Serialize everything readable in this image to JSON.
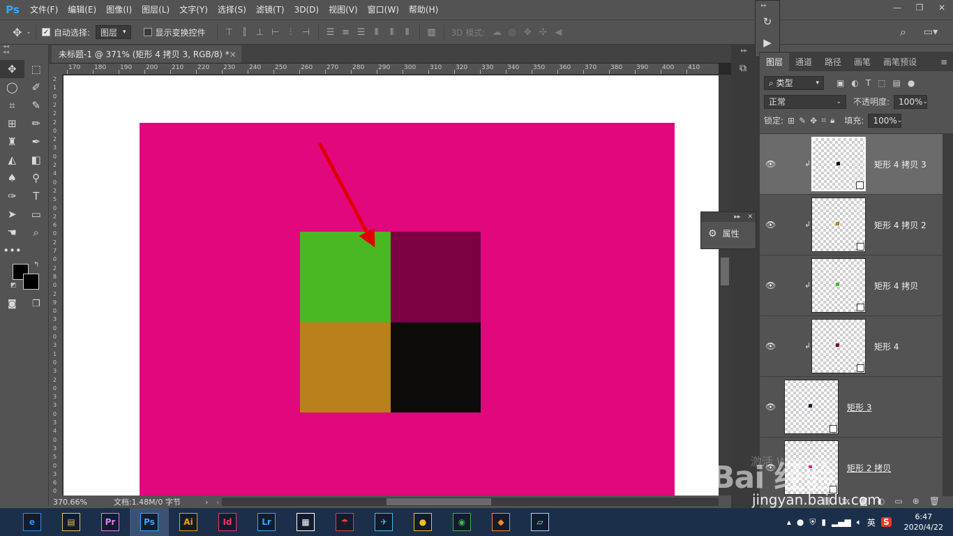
{
  "app": {
    "logo": "Ps",
    "brand_color": "#31a8ff"
  },
  "menu": [
    "文件(F)",
    "编辑(E)",
    "图像(I)",
    "图层(L)",
    "文字(Y)",
    "选择(S)",
    "滤镜(T)",
    "3D(D)",
    "视图(V)",
    "窗口(W)",
    "帮助(H)"
  ],
  "options": {
    "auto_select_label": "自动选择:",
    "auto_select_checked": "✓",
    "target": "图层",
    "show_transform_label": "显示变换控件",
    "mode_3d_label": "3D 模式:"
  },
  "document": {
    "tab_title": "未标题-1 @ 371% (矩形 4 拷贝 3, RGB/8) *",
    "tab_close": "×",
    "ruler_labels": [
      "170",
      "180",
      "190",
      "200",
      "210",
      "220",
      "230",
      "240",
      "250",
      "260",
      "270",
      "280",
      "290",
      "300",
      "310",
      "320",
      "330",
      "340",
      "350",
      "360",
      "370",
      "380",
      "390",
      "400",
      "410"
    ],
    "left_ruler_digits": [
      "2",
      "1",
      "0",
      "2",
      "2",
      "2",
      "0",
      "2",
      "3",
      "0",
      "2",
      "4",
      "0",
      "2",
      "5",
      "0",
      "2",
      "6",
      "0",
      "2",
      "7",
      "0",
      "2",
      "8",
      "0",
      "2",
      "9",
      "0",
      "3",
      "0",
      "0",
      "3",
      "1",
      "0",
      "3",
      "2",
      "0",
      "3",
      "3",
      "0",
      "3",
      "4",
      "0",
      "3",
      "5",
      "0",
      "3",
      "6",
      "0"
    ]
  },
  "canvas": {
    "background": "#ffffff",
    "shape_color": "#e3077e",
    "squares": [
      {
        "name": "green-square",
        "color": "#49b823"
      },
      {
        "name": "maroon-square",
        "color": "#7c0042"
      },
      {
        "name": "ochre-square",
        "color": "#b9801c"
      },
      {
        "name": "black-square",
        "color": "#0e0c0b"
      }
    ],
    "arrow_color": "#e00000"
  },
  "status": {
    "zoom": "370.66%",
    "doc_info": "文档:1.48M/0 字节"
  },
  "properties_panel": {
    "label": "属性"
  },
  "layers_panel": {
    "tabs": [
      "图层",
      "通道",
      "路径",
      "画笔",
      "画笔预设"
    ],
    "active_tab": 0,
    "filter_label": "类型",
    "blend_mode": "正常",
    "opacity_label": "不透明度:",
    "opacity_value": "100%",
    "lock_label": "锁定:",
    "fill_label": "填充:",
    "fill_value": "100%",
    "layers": [
      {
        "name": "矩形 4 拷贝 3",
        "dot_color": "#0e0c0b",
        "clipped": true,
        "selected": true
      },
      {
        "name": "矩形 4 拷贝 2",
        "dot_color": "#b9801c",
        "clipped": true,
        "selected": false
      },
      {
        "name": "矩形 4 拷贝",
        "dot_color": "#49b823",
        "clipped": true,
        "selected": false
      },
      {
        "name": "矩形 4",
        "dot_color": "#7c0042",
        "clipped": true,
        "selected": false
      },
      {
        "name": "矩形 3",
        "dot_color": "#2a0a3a",
        "clipped": false,
        "selected": false
      },
      {
        "name": "矩形 2 拷贝",
        "dot_color": "#e3077e",
        "clipped": false,
        "selected": false
      }
    ]
  },
  "taskbar": {
    "apps": [
      {
        "name": "browser-360",
        "label": "e",
        "color": "#2a8ef0"
      },
      {
        "name": "file-explorer",
        "label": "▤",
        "color": "#e8c25a"
      },
      {
        "name": "premiere",
        "label": "Pr",
        "color": "#e77bff"
      },
      {
        "name": "photoshop",
        "label": "Ps",
        "color": "#31a8ff"
      },
      {
        "name": "illustrator",
        "label": "Ai",
        "color": "#ff9a00"
      },
      {
        "name": "indesign",
        "label": "Id",
        "color": "#ff3366"
      },
      {
        "name": "lightroom",
        "label": "Lr",
        "color": "#31a8ff"
      },
      {
        "name": "video-app",
        "label": "▦",
        "color": "#ffffff"
      },
      {
        "name": "umbrella-app",
        "label": "☂",
        "color": "#e04040"
      },
      {
        "name": "paper-plane-app",
        "label": "✈",
        "color": "#4ab8f0"
      },
      {
        "name": "qq",
        "label": "●",
        "color": "#f0c020"
      },
      {
        "name": "chrome",
        "label": "◉",
        "color": "#4caf50"
      },
      {
        "name": "fox-app",
        "label": "◆",
        "color": "#ff8a20"
      },
      {
        "name": "notes-app",
        "label": "▱",
        "color": "#9fd8ff"
      }
    ],
    "ime": "英",
    "time": "6:47",
    "date": "2020/4/22"
  },
  "watermark": {
    "logo": "Bai 经验",
    "url": "jingyan.baidu.com",
    "hint": "激活 Windows"
  }
}
